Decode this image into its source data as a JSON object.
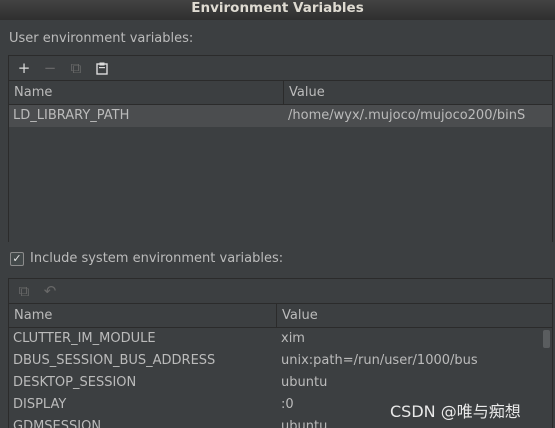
{
  "window": {
    "title": "Environment Variables"
  },
  "user_section": {
    "label": "User environment variables:",
    "toolbar": {
      "add": "+",
      "remove": "−",
      "copy": "⧉",
      "paste": "📋"
    },
    "columns": [
      "Name",
      "Value"
    ],
    "rows": [
      {
        "name": "LD_LIBRARY_PATH",
        "value": "/home/wyx/.mujoco/mujoco200/binS"
      }
    ]
  },
  "include_system": {
    "label": "Include system environment variables:",
    "checked": true
  },
  "system_section": {
    "toolbar": {
      "copy": "⧉",
      "reset": "↶"
    },
    "columns": [
      "Name",
      "Value"
    ],
    "rows": [
      {
        "name": "CLUTTER_IM_MODULE",
        "value": "xim"
      },
      {
        "name": "DBUS_SESSION_BUS_ADDRESS",
        "value": "unix:path=/run/user/1000/bus"
      },
      {
        "name": "DESKTOP_SESSION",
        "value": "ubuntu"
      },
      {
        "name": "DISPLAY",
        "value": ":0"
      },
      {
        "name": "GDMSESSION",
        "value": "ubuntu"
      }
    ]
  },
  "watermark": "CSDN @唯与痴想"
}
